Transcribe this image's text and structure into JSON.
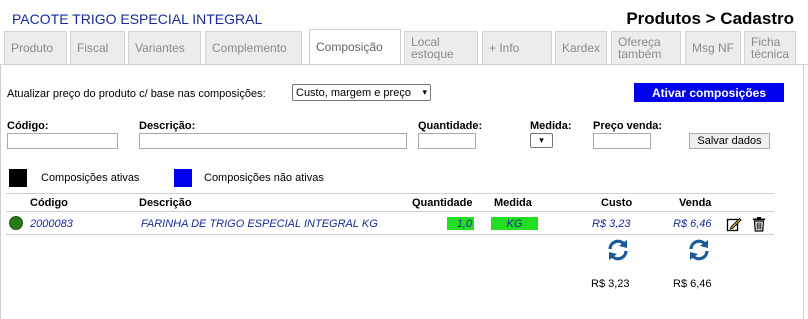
{
  "header": {
    "product_name": "PACOTE TRIGO ESPECIAL INTEGRAL",
    "section_title": "Produtos > Cadastro"
  },
  "tabs": [
    {
      "label": "Produto",
      "active": false
    },
    {
      "label": "Fiscal",
      "active": false
    },
    {
      "label": "Variantes",
      "active": false
    },
    {
      "label": "Complemento",
      "active": false
    },
    {
      "label": "Composição",
      "active": true
    },
    {
      "label": "Local\nestoque",
      "active": false
    },
    {
      "label": "+ Info",
      "active": false
    },
    {
      "label": "Kardex",
      "active": false
    },
    {
      "label": "Ofereça\ntambém",
      "active": false
    },
    {
      "label": "Msg NF",
      "active": false
    },
    {
      "label": "Ficha\ntécnica",
      "active": false
    }
  ],
  "update_price": {
    "label": "Atualizar preço do produto c/ base nas composições:",
    "selected_option": "Custo, margem e preço"
  },
  "activate_button": "Ativar composições",
  "form": {
    "codigo_label": "Código:",
    "descricao_label": "Descrição:",
    "quantidade_label": "Quantidade:",
    "medida_label": "Medida:",
    "preco_venda_label": "Preço venda:",
    "save_button": "Salvar dados"
  },
  "legend": {
    "active_label": "Composições ativas",
    "active_color": "#000000",
    "inactive_label": "Composições não ativas",
    "inactive_color": "#0000ee"
  },
  "table": {
    "headers": {
      "codigo": "Código",
      "descricao": "Descrição",
      "quantidade": "Quantidade",
      "medida": "Medida",
      "custo": "Custo",
      "venda": "Venda"
    },
    "rows": [
      {
        "status_color": "#2a7a1a",
        "codigo": "2000083",
        "descricao": "FARINHA DE TRIGO ESPECIAL INTEGRAL KG",
        "quantidade": "1,0",
        "medida": "KG",
        "custo": "R$ 3,23",
        "venda": "R$ 6,46",
        "highlight_color": "#22dd22",
        "actions": [
          "edit-icon",
          "trash-icon"
        ]
      }
    ]
  },
  "totals": {
    "custo": "R$ 3,23",
    "venda": "R$ 6,46",
    "refresh_icon": "refresh-icon"
  }
}
